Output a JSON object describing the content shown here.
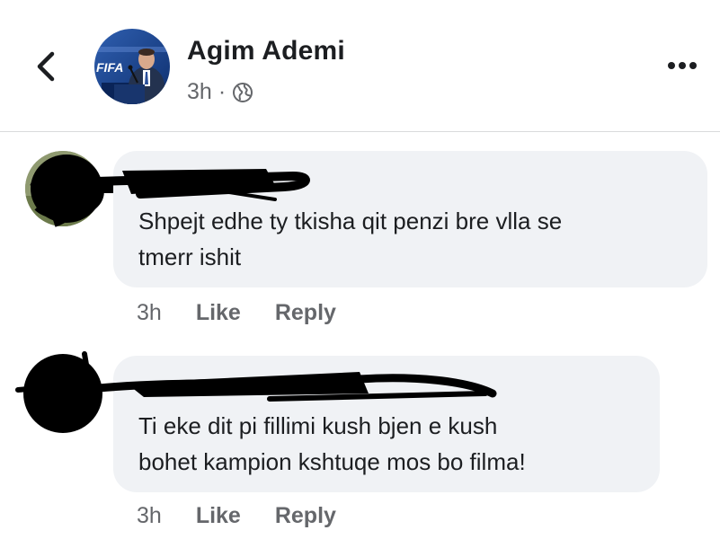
{
  "post": {
    "author": "Agim Ademi",
    "time": "3h",
    "separator": "·",
    "avatar_text": "FIFA",
    "icons": [
      "chevron-left-icon",
      "globe-icon",
      "more-horizontal-icon"
    ]
  },
  "comments": [
    {
      "text_line1": "Shpejt edhe ty tkisha qit penzi bre vlla se",
      "text_line2": "tmerr ishit",
      "time": "3h",
      "like": "Like",
      "reply": "Reply"
    },
    {
      "text_line1": "Ti eke dit pi fillimi kush bjen e kush",
      "text_line2": "bohet kampion kshtuqe mos bo filma!",
      "time": "3h",
      "like": "Like",
      "reply": "Reply"
    }
  ],
  "colors": {
    "bubble": "#f0f2f5",
    "text": "#1c1e21",
    "secondary": "#65676b",
    "divider": "#d9dadc"
  }
}
